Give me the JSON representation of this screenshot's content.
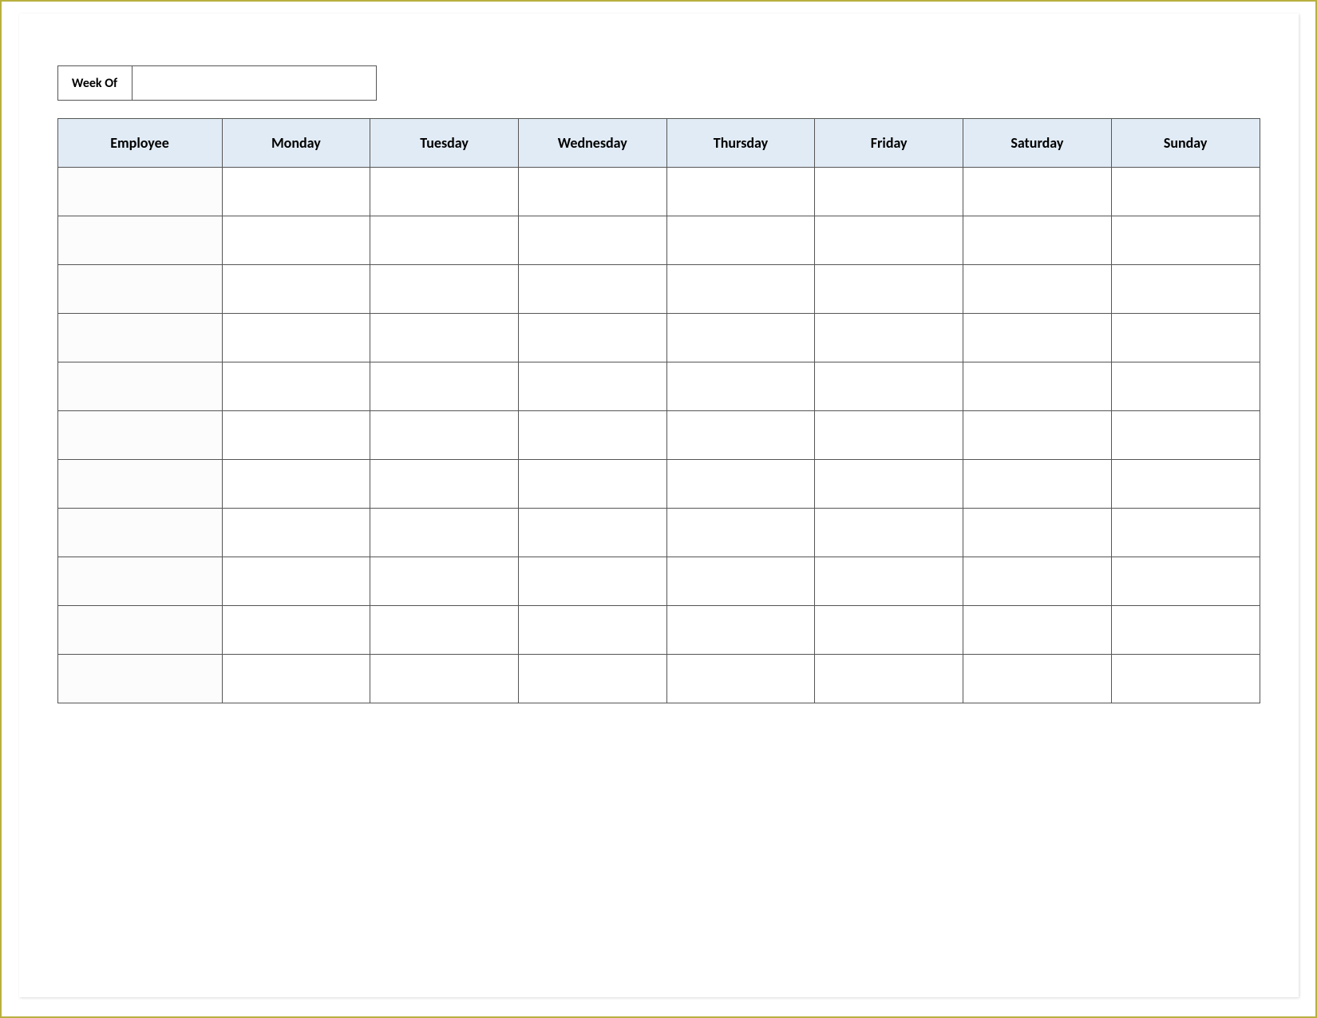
{
  "weekOf": {
    "label": "Week Of",
    "value": ""
  },
  "headers": {
    "employee": "Employee",
    "days": [
      "Monday",
      "Tuesday",
      "Wednesday",
      "Thursday",
      "Friday",
      "Saturday",
      "Sunday"
    ]
  },
  "rows": [
    {
      "employee": "",
      "monday": "",
      "tuesday": "",
      "wednesday": "",
      "thursday": "",
      "friday": "",
      "saturday": "",
      "sunday": ""
    },
    {
      "employee": "",
      "monday": "",
      "tuesday": "",
      "wednesday": "",
      "thursday": "",
      "friday": "",
      "saturday": "",
      "sunday": ""
    },
    {
      "employee": "",
      "monday": "",
      "tuesday": "",
      "wednesday": "",
      "thursday": "",
      "friday": "",
      "saturday": "",
      "sunday": ""
    },
    {
      "employee": "",
      "monday": "",
      "tuesday": "",
      "wednesday": "",
      "thursday": "",
      "friday": "",
      "saturday": "",
      "sunday": ""
    },
    {
      "employee": "",
      "monday": "",
      "tuesday": "",
      "wednesday": "",
      "thursday": "",
      "friday": "",
      "saturday": "",
      "sunday": ""
    },
    {
      "employee": "",
      "monday": "",
      "tuesday": "",
      "wednesday": "",
      "thursday": "",
      "friday": "",
      "saturday": "",
      "sunday": ""
    },
    {
      "employee": "",
      "monday": "",
      "tuesday": "",
      "wednesday": "",
      "thursday": "",
      "friday": "",
      "saturday": "",
      "sunday": ""
    },
    {
      "employee": "",
      "monday": "",
      "tuesday": "",
      "wednesday": "",
      "thursday": "",
      "friday": "",
      "saturday": "",
      "sunday": ""
    },
    {
      "employee": "",
      "monday": "",
      "tuesday": "",
      "wednesday": "",
      "thursday": "",
      "friday": "",
      "saturday": "",
      "sunday": ""
    },
    {
      "employee": "",
      "monday": "",
      "tuesday": "",
      "wednesday": "",
      "thursday": "",
      "friday": "",
      "saturday": "",
      "sunday": ""
    },
    {
      "employee": "",
      "monday": "",
      "tuesday": "",
      "wednesday": "",
      "thursday": "",
      "friday": "",
      "saturday": "",
      "sunday": ""
    }
  ]
}
